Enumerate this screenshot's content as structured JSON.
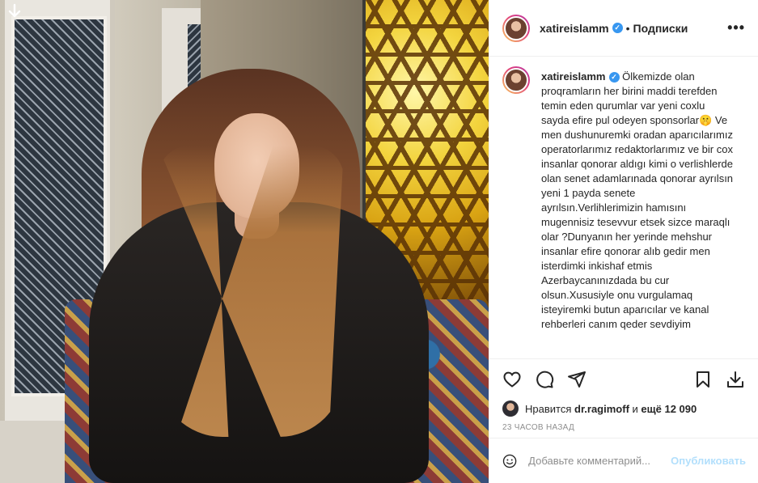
{
  "post": {
    "username": "xatireislamm",
    "follow_label": "Подписки",
    "caption": "Ölkemizde olan proqramların her birini maddi terefden temin eden qurumlar var yeni coxlu sayda efire pul odeyen sponsorlar🤫 Ve men dushunuremki oradan aparıcılarımız operatorlarımız redaktorlarımız ve bir cox insanlar qonorar aldıgı kimi o verlishlerde olan senet adamlarınada qonorar ayrılsın yeni 1 payda senete ayrılsın.Verlihlerimizin hamısını mugennisiz tesevvur etsek sizce maraqlı olar ?Dunyanın her yerinde mehshur insanlar efire qonorar alıb gedir men isterdimki inkishaf etmis Azerbaycanınızdada bu cur olsun.Xususiyle onu vurgulamaq isteyiremki butun aparıcılar ve kanal rehberleri canım qeder sevdiyim"
  },
  "likes": {
    "prefix": "Нравится",
    "user": "dr.ragimoff",
    "and": "и",
    "rest": "ещё 12 090"
  },
  "time": "23 ЧАСОВ НАЗАД",
  "comment_box": {
    "placeholder": "Добавьте комментарий...",
    "publish_label": "Опубликовать"
  },
  "icons": {
    "more": "more-icon",
    "like": "heart-icon",
    "comment": "comment-icon",
    "share": "share-icon",
    "save": "bookmark-icon",
    "download": "download-icon",
    "emoji": "smile-icon",
    "verified": "verified-icon"
  },
  "colors": {
    "accent": "#3897f0",
    "publish_disabled": "#b2dffc",
    "muted": "#8e8e8e"
  }
}
